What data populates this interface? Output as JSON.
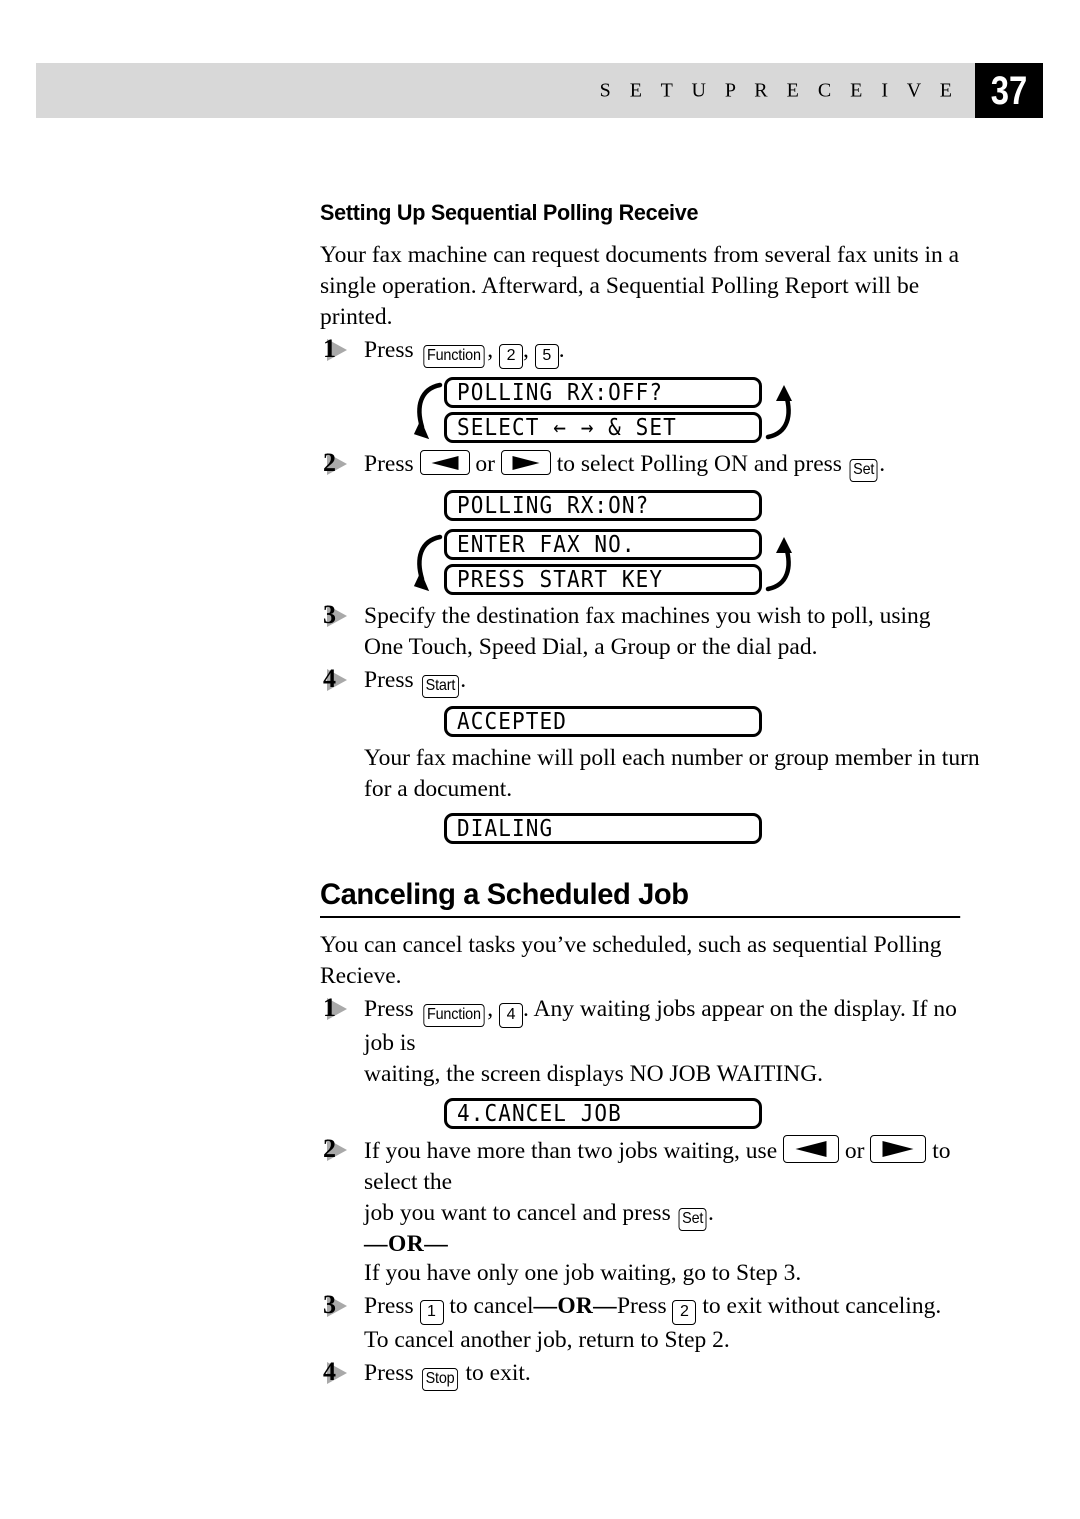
{
  "header": {
    "title": "S E T U P   R E C E I V E",
    "page_number": "37"
  },
  "sections": [
    {
      "id": "sequential-polling",
      "heading": "Setting Up Sequential Polling Receive",
      "intro": "Your fax machine can request documents from several fax units in a single operation. Afterward, a Sequential Polling Report will be printed.",
      "steps": {
        "s1": {
          "number": "1",
          "press_label": "Press",
          "key_function": "Function",
          "key_2": "2",
          "key_5": "5",
          "sep1": ", ",
          "sep2": ", ",
          "end": "."
        },
        "s2": {
          "number": "2",
          "press_label": "Press",
          "or_label": "or",
          "mid": "to select Polling ON and press",
          "key_set": "Set",
          "end": "."
        },
        "s3": {
          "number": "3",
          "line1": "Specify the destination fax machines you wish to poll, using",
          "line2": "One Touch, Speed Dial, a Group or the dial pad."
        },
        "s4": {
          "number": "4",
          "press_label": "Press",
          "key_start": "Start",
          "end": "."
        }
      },
      "lcd_polling_off": {
        "line1": "POLLING RX:OFF?",
        "line2": "SELECT ← → & SET",
        "cycling": true
      },
      "lcd_polling_on": {
        "line1": "POLLING RX:ON?",
        "cycling": false
      },
      "lcd_enter_fax": {
        "line1": "ENTER FAX NO.",
        "line2": "PRESS START KEY",
        "cycling": true
      },
      "lcd_accepted": {
        "line1": "ACCEPTED",
        "cycling": false
      },
      "note_after_accepted": "Your fax machine will poll each number or group member in turn for a document.",
      "lcd_dialing": {
        "line1": "DIALING",
        "cycling": false
      }
    },
    {
      "id": "canceling-scheduled-job",
      "heading": "Canceling a Scheduled Job",
      "intro": "You can cancel tasks you’ve scheduled, such as sequential Polling Recieve.",
      "steps": {
        "s1": {
          "number": "1",
          "press_label": "Press",
          "key_function": "Function",
          "key_4": "4",
          "after": ". Any waiting jobs appear on the display. If no job is",
          "line2": "waiting, the screen displays NO JOB WAITING."
        },
        "s2": {
          "number": "2",
          "lead": "If you have more than two jobs waiting, use",
          "or_label": "or",
          "mid": "to select the",
          "line2": "job you want to cancel and press",
          "key_set": "Set",
          "end": "."
        },
        "or_divider": "—OR—",
        "or_text": "If you have only one job waiting, go to Step 3.",
        "s3": {
          "number": "3",
          "press_label": "Press",
          "key_1": "1",
          "mid1": "to cancel",
          "or_bold": "—OR—",
          "press2": "Press",
          "key_2": "2",
          "mid2": "to exit without canceling.",
          "line2": "To cancel another job, return to Step 2."
        },
        "s4": {
          "number": "4",
          "press_label": "Press",
          "key_stop": "Stop",
          "end": "to exit."
        }
      },
      "lcd_cancel_job": {
        "line1": "4.CANCEL JOB",
        "cycling": false
      }
    }
  ],
  "colors": {
    "header_band": "#d8d8d8",
    "page_box": "#000000",
    "step_marker": "#a9a9a9",
    "text": "#000000"
  }
}
